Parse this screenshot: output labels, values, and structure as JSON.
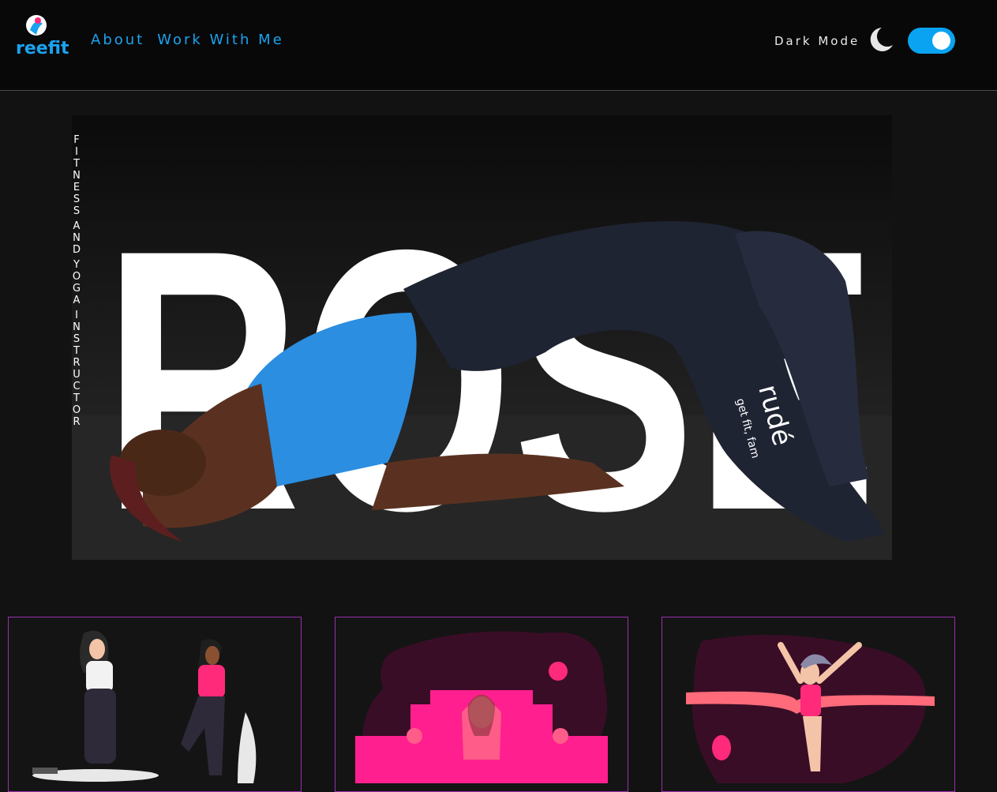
{
  "header": {
    "logo_text": "reefit",
    "nav": [
      {
        "label": "About"
      },
      {
        "label": "Work With Me"
      }
    ],
    "dark_mode_label": "Dark Mode",
    "dark_mode_on": true
  },
  "hero": {
    "big_title": "ROSE",
    "tagline_letters": [
      "F",
      "I",
      "T",
      "N",
      "E",
      "S",
      "S",
      " ",
      "A",
      "N",
      "D",
      " ",
      "Y",
      "O",
      "G",
      "A",
      " ",
      "I",
      "N",
      "S",
      "T",
      "R",
      "U",
      "C",
      "T",
      "O",
      "R"
    ],
    "legging_brand": "rudé",
    "legging_slogan": "get fit, fam"
  },
  "colors": {
    "accent_blue": "#1aa3f0",
    "accent_pink": "#ff2a7a",
    "card_border": "#9b2fb0"
  },
  "cards": [
    {
      "illustration": "two-women-workout-illustration"
    },
    {
      "illustration": "meditation-yoga-illustration"
    },
    {
      "illustration": "finish-line-runner-illustration"
    }
  ]
}
